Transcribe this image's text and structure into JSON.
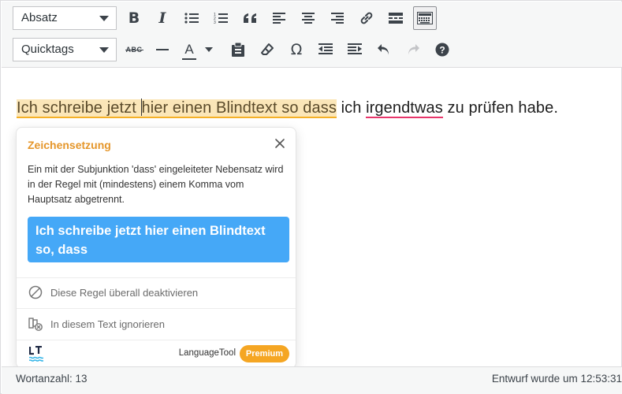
{
  "toolbar": {
    "format_select": "Absatz",
    "quicktags_select": "Quicktags",
    "strikethrough_label": "ABC",
    "text_color_label": "A",
    "omega_label": "Ω"
  },
  "editor": {
    "highlight_part1": "Ich schreibe jetzt ",
    "highlight_part2": "hier einen Blindtext so dass",
    "plain_1": " ich ",
    "error_word": "irgendtwas",
    "plain_2": " zu prüfen habe."
  },
  "popup": {
    "title": "Zeichensetzung",
    "message": "Ein mit der Subjunktion 'dass' eingeleiteter Nebensatz wird in der Regel mit (mindestens) einem Komma vom Hauptsatz abgetrennt.",
    "suggestion": "Ich schreibe jetzt hier einen Blindtext so, dass",
    "action_disable": "Diese Regel überall deaktivieren",
    "action_ignore": "In diesem Text ignorieren",
    "brand": "LanguageTool",
    "premium": "Premium"
  },
  "status": {
    "word_count": "Wortanzahl: 13",
    "saved": "Entwurf wurde um 12:53:31"
  },
  "colors": {
    "accent_orange": "#e5962a",
    "suggestion_blue": "#45a8f7",
    "error_pink": "#e8366b",
    "highlight": "#fbe6b8"
  },
  "icons": [
    "bold-icon",
    "italic-icon",
    "bullet-list-icon",
    "numbered-list-icon",
    "blockquote-icon",
    "align-left-icon",
    "align-center-icon",
    "align-right-icon",
    "link-icon",
    "read-more-icon",
    "toolbar-toggle-icon",
    "strikethrough-icon",
    "horizontal-line-icon",
    "text-color-icon",
    "paste-text-icon",
    "eraser-icon",
    "omega-icon",
    "outdent-icon",
    "indent-icon",
    "undo-icon",
    "redo-icon",
    "help-icon",
    "close-icon",
    "block-icon",
    "ignore-icon",
    "languagetool-logo-icon"
  ]
}
